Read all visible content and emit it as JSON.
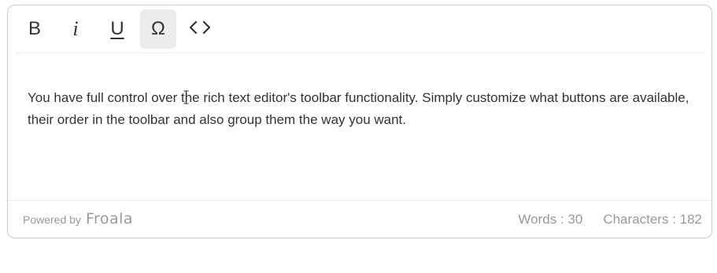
{
  "toolbar": {
    "buttons": [
      {
        "name": "bold",
        "glyph": "B",
        "active": false
      },
      {
        "name": "italic",
        "glyph": "i",
        "active": false
      },
      {
        "name": "underline",
        "glyph": "U",
        "active": false
      },
      {
        "name": "special-characters",
        "glyph": "Ω",
        "active": true
      },
      {
        "name": "code-view",
        "glyph": "<>",
        "active": false
      }
    ]
  },
  "content": {
    "text": "You have full control over the rich text editor's toolbar functionality. Simply customize what buttons are available, their order in the toolbar and also group them the way you want."
  },
  "footer": {
    "powered_by": "Powered by",
    "brand": "Froala",
    "words": "Words : 30",
    "characters": "Characters : 182"
  },
  "colors": {
    "text": "#333333",
    "muted": "#999999",
    "active_bg": "#ececec",
    "border": "#cccccc"
  }
}
